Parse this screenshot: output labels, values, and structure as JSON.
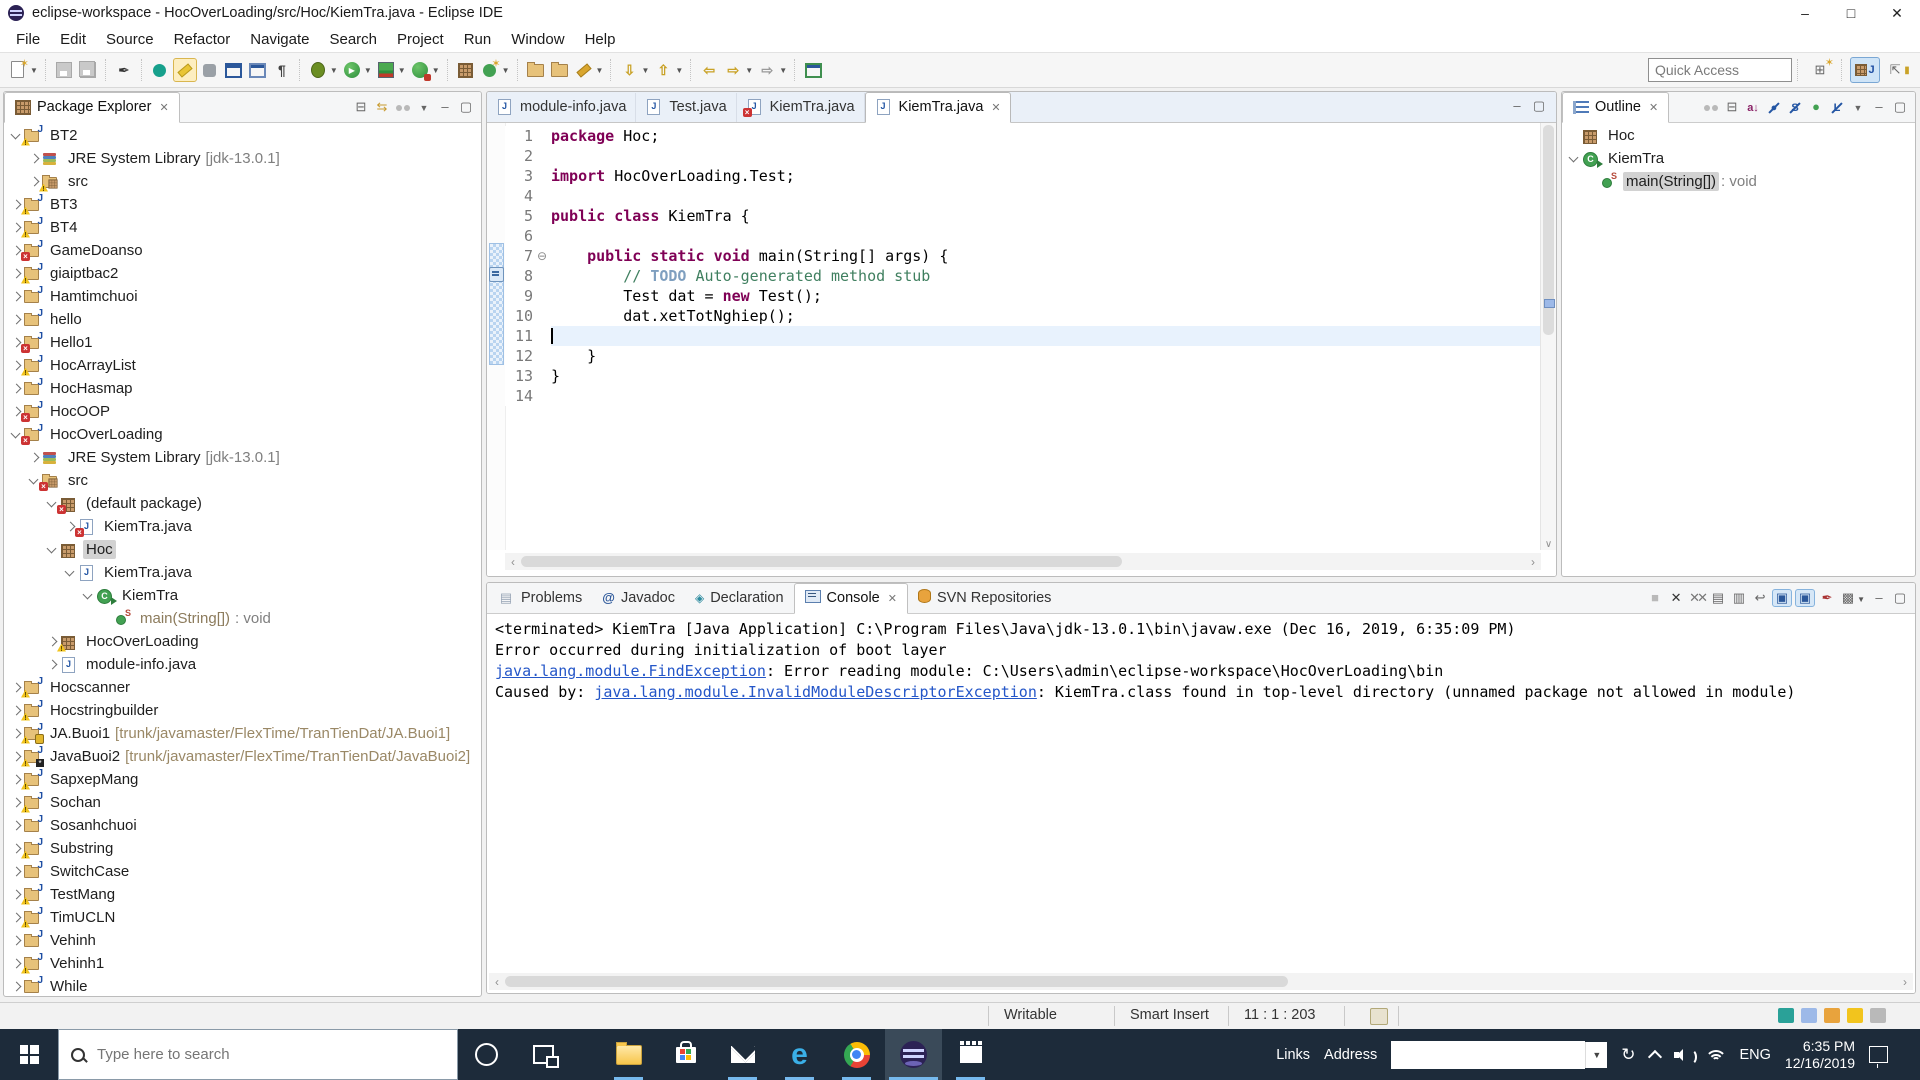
{
  "window": {
    "title": "eclipse-workspace - HocOverLoading/src/Hoc/KiemTra.java - Eclipse IDE",
    "controls": [
      "minimize",
      "maximize",
      "close"
    ]
  },
  "menu": {
    "items": [
      "File",
      "Edit",
      "Source",
      "Refactor",
      "Navigate",
      "Search",
      "Project",
      "Run",
      "Window",
      "Help"
    ]
  },
  "toolbar": {
    "quick_access_placeholder": "Quick Access",
    "groups": [
      [
        "new-wizard"
      ],
      [
        "save",
        "save-all"
      ],
      [
        "pin"
      ],
      [
        "external-tools",
        "mark-occurrences",
        "jar",
        "open-type",
        "templates",
        "show-whitespace"
      ],
      [
        "debug",
        "run",
        "coverage",
        "profile"
      ],
      [
        "new-java-project",
        "new-wizard-java"
      ],
      [
        "open-folder",
        "open-folder-2",
        "search-flashlight"
      ],
      [
        "next-annotation",
        "prev-annotation"
      ],
      [
        "back",
        "forward",
        "forward-gray"
      ],
      [
        "last-edit-location"
      ]
    ],
    "perspectives": [
      "open-perspective",
      "java-perspective",
      "jee-perspective"
    ]
  },
  "package_explorer": {
    "title": "Package Explorer",
    "toolbar": [
      "collapse-all-icon",
      "link-with-editor-icon",
      "focus-icon",
      "view-menu-icon",
      "minimize-icon",
      "maximize-icon"
    ],
    "items": [
      {
        "d": 0,
        "e": "v",
        "i": "prj",
        "b": [
          "w"
        ],
        "t": "BT2"
      },
      {
        "d": 1,
        "e": ">",
        "i": "jre",
        "t": "JRE System Library",
        "s": " [jdk-13.0.1]",
        "sc": "g"
      },
      {
        "d": 1,
        "e": ">",
        "i": "src",
        "b": [
          "w"
        ],
        "t": "src"
      },
      {
        "d": 0,
        "e": ">",
        "i": "prj",
        "b": [
          "w"
        ],
        "t": "BT3"
      },
      {
        "d": 0,
        "e": ">",
        "i": "prj",
        "b": [
          "w"
        ],
        "t": "BT4"
      },
      {
        "d": 0,
        "e": ">",
        "i": "prj",
        "b": [
          "e"
        ],
        "t": "GameDoanso"
      },
      {
        "d": 0,
        "e": ">",
        "i": "prj",
        "b": [
          "w"
        ],
        "t": "giaiptbac2"
      },
      {
        "d": 0,
        "e": ">",
        "i": "prj",
        "t": "Hamtimchuoi"
      },
      {
        "d": 0,
        "e": ">",
        "i": "prj",
        "t": "hello"
      },
      {
        "d": 0,
        "e": ">",
        "i": "prj",
        "b": [
          "e"
        ],
        "t": "Hello1"
      },
      {
        "d": 0,
        "e": ">",
        "i": "prj",
        "b": [
          "w"
        ],
        "t": "HocArrayList"
      },
      {
        "d": 0,
        "e": ">",
        "i": "prj",
        "t": "HocHasmap"
      },
      {
        "d": 0,
        "e": ">",
        "i": "prj",
        "b": [
          "e"
        ],
        "t": "HocOOP"
      },
      {
        "d": 0,
        "e": "v",
        "i": "prj",
        "b": [
          "e"
        ],
        "t": "HocOverLoading"
      },
      {
        "d": 1,
        "e": ">",
        "i": "jre",
        "t": "JRE System Library",
        "s": " [jdk-13.0.1]",
        "sc": "g"
      },
      {
        "d": 1,
        "e": "v",
        "i": "src",
        "b": [
          "e"
        ],
        "t": "src"
      },
      {
        "d": 2,
        "e": "v",
        "i": "pkg",
        "b": [
          "e"
        ],
        "t": "(default package)"
      },
      {
        "d": 3,
        "e": ">",
        "i": "jfile",
        "b": [
          "e"
        ],
        "t": "KiemTra.java"
      },
      {
        "d": 2,
        "e": "v",
        "i": "pkg",
        "t": "Hoc",
        "sel": true
      },
      {
        "d": 3,
        "e": "v",
        "i": "jfile",
        "t": "KiemTra.java"
      },
      {
        "d": 4,
        "e": "v",
        "i": "cls",
        "t": "KiemTra"
      },
      {
        "d": 5,
        "e": "",
        "i": "mth",
        "t": "main(String[])",
        "s": " : void",
        "sc": "g",
        "dim": true
      },
      {
        "d": 2,
        "e": ">",
        "i": "pkg",
        "b": [
          "w"
        ],
        "t": "HocOverLoading"
      },
      {
        "d": 2,
        "e": ">",
        "i": "jfile",
        "t": "module-info.java"
      },
      {
        "d": 0,
        "e": ">",
        "i": "prj",
        "b": [
          "w"
        ],
        "t": "Hocscanner"
      },
      {
        "d": 0,
        "e": ">",
        "i": "prj",
        "b": [
          "w"
        ],
        "t": "Hocstringbuilder"
      },
      {
        "d": 0,
        "e": ">",
        "i": "prj",
        "b": [
          "w",
          "k"
        ],
        "t": "JA.Buoi1",
        "s": " [trunk/javamaster/FlexTime/TranTienDat/JA.Buoi1]",
        "sc": "r"
      },
      {
        "d": 0,
        "e": ">",
        "i": "prj",
        "b": [
          "w",
          "s"
        ],
        "t": "JavaBuoi2",
        "s": " [trunk/javamaster/FlexTime/TranTienDat/JavaBuoi2]",
        "sc": "r"
      },
      {
        "d": 0,
        "e": ">",
        "i": "prj",
        "b": [
          "w"
        ],
        "t": "SapxepMang"
      },
      {
        "d": 0,
        "e": ">",
        "i": "prj",
        "b": [
          "w"
        ],
        "t": "Sochan"
      },
      {
        "d": 0,
        "e": ">",
        "i": "prj",
        "t": "Sosanhchuoi"
      },
      {
        "d": 0,
        "e": ">",
        "i": "prj",
        "b": [
          "w"
        ],
        "t": "Substring"
      },
      {
        "d": 0,
        "e": ">",
        "i": "prj",
        "t": "SwitchCase"
      },
      {
        "d": 0,
        "e": ">",
        "i": "prj",
        "b": [
          "w"
        ],
        "t": "TestMang"
      },
      {
        "d": 0,
        "e": ">",
        "i": "prj",
        "b": [
          "w"
        ],
        "t": "TimUCLN"
      },
      {
        "d": 0,
        "e": ">",
        "i": "prj",
        "t": "Vehinh"
      },
      {
        "d": 0,
        "e": ">",
        "i": "prj",
        "b": [
          "w"
        ],
        "t": "Vehinh1"
      },
      {
        "d": 0,
        "e": ">",
        "i": "prj",
        "t": "While"
      }
    ]
  },
  "editor": {
    "tabs": [
      {
        "t": "module-info.java",
        "i": "jfile"
      },
      {
        "t": "Test.java",
        "i": "jfile"
      },
      {
        "t": "KiemTra.java",
        "i": "jfile",
        "b": [
          "e"
        ]
      },
      {
        "t": "KiemTra.java",
        "i": "jfile",
        "active": true,
        "close": true
      }
    ],
    "lines": [
      {
        "n": 1,
        "segs": [
          [
            "kw",
            "package"
          ],
          [
            "pl",
            " Hoc;"
          ]
        ]
      },
      {
        "n": 2,
        "segs": []
      },
      {
        "n": 3,
        "segs": [
          [
            "kw",
            "import"
          ],
          [
            "pl",
            " HocOverLoading.Test;"
          ]
        ]
      },
      {
        "n": 4,
        "segs": []
      },
      {
        "n": 5,
        "segs": [
          [
            "kw",
            "public"
          ],
          [
            "pl",
            " "
          ],
          [
            "kw",
            "class"
          ],
          [
            "pl",
            " KiemTra {"
          ]
        ]
      },
      {
        "n": 6,
        "segs": []
      },
      {
        "n": 7,
        "fold": true,
        "segs": [
          [
            "pl",
            "    "
          ],
          [
            "kw",
            "public"
          ],
          [
            "pl",
            " "
          ],
          [
            "kw",
            "static"
          ],
          [
            "pl",
            " "
          ],
          [
            "kw",
            "void"
          ],
          [
            "pl",
            " main(String[] args) {"
          ]
        ]
      },
      {
        "n": 8,
        "segs": [
          [
            "pl",
            "        "
          ],
          [
            "cm",
            "// "
          ],
          [
            "td",
            "TODO"
          ],
          [
            "cm",
            " Auto-generated method stub"
          ]
        ]
      },
      {
        "n": 9,
        "segs": [
          [
            "pl",
            "        Test dat = "
          ],
          [
            "kw",
            "new"
          ],
          [
            "pl",
            " Test();"
          ]
        ]
      },
      {
        "n": 10,
        "segs": [
          [
            "pl",
            "        dat.xetTotNghiep();"
          ]
        ]
      },
      {
        "n": 11,
        "cur": true,
        "segs": []
      },
      {
        "n": 12,
        "segs": [
          [
            "pl",
            "    }"
          ]
        ]
      },
      {
        "n": 13,
        "segs": [
          [
            "pl",
            "}"
          ]
        ]
      },
      {
        "n": 14,
        "segs": []
      }
    ]
  },
  "outline": {
    "title": "Outline",
    "toolbar": [
      "focus-icon",
      "collapse-all-icon",
      "sort-icon",
      "hide-fields-icon",
      "hide-static-icon",
      "hide-non-public-icon",
      "hide-local-types-icon",
      "view-menu-icon",
      "minimize-icon",
      "maximize-icon"
    ],
    "items": [
      {
        "d": 0,
        "e": "",
        "i": "pkg",
        "t": "Hoc"
      },
      {
        "d": 0,
        "e": "v",
        "i": "cls",
        "t": "KiemTra"
      },
      {
        "d": 1,
        "e": "",
        "i": "mth",
        "t": "main(String[])",
        "s": " : void",
        "sc": "g",
        "sel": true
      }
    ]
  },
  "console": {
    "tabs": [
      {
        "t": "Problems",
        "i": "problems"
      },
      {
        "t": "Javadoc",
        "i": "javadoc"
      },
      {
        "t": "Declaration",
        "i": "declaration"
      },
      {
        "t": "Console",
        "i": "console",
        "active": true,
        "close": true
      },
      {
        "t": "SVN Repositories",
        "i": "svn"
      }
    ],
    "toolbar": [
      "terminate-icon",
      "close-console-icon",
      "remove-all-launches-icon",
      "clear-console-icon",
      "scroll-lock-icon",
      "word-wrap-icon",
      "stdout-lock-icon",
      "stderr-lock-icon",
      "pin-console-icon",
      "open-console-icon",
      "minimize-icon",
      "maximize-icon"
    ],
    "title_line": "<terminated> KiemTra [Java Application] C:\\Program Files\\Java\\jdk-13.0.1\\bin\\javaw.exe (Dec 16, 2019, 6:35:09 PM)",
    "lines": [
      [
        [
          "p",
          "Error occurred during initialization of boot layer"
        ]
      ],
      [
        [
          "l",
          "java.lang.module.FindException"
        ],
        [
          "p",
          ": Error reading module: C:\\Users\\admin\\eclipse-workspace\\HocOverLoading\\bin"
        ]
      ],
      [
        [
          "p",
          "Caused by: "
        ],
        [
          "l",
          "java.lang.module.InvalidModuleDescriptorException"
        ],
        [
          "p",
          ": KiemTra.class found in top-level directory (unnamed package not allowed in module)"
        ]
      ]
    ]
  },
  "status_bar": {
    "writable": "Writable",
    "insert_mode": "Smart Insert",
    "position": "11 : 1 : 203"
  },
  "taskbar": {
    "search_placeholder": "Type here to search",
    "links_label": "Links",
    "address_label": "Address",
    "language": "ENG",
    "time": "6:35 PM",
    "date": "12/16/2019",
    "apps": [
      {
        "n": "file-explorer",
        "open": true
      },
      {
        "n": "store",
        "open": false
      },
      {
        "n": "mail",
        "open": true
      },
      {
        "n": "edge",
        "open": true
      },
      {
        "n": "chrome",
        "open": true
      },
      {
        "n": "eclipse",
        "open": true,
        "active": true
      },
      {
        "n": "movies-tv",
        "open": true
      }
    ]
  },
  "colors": {
    "keyword": "#7f0055",
    "comment": "#3f7f5f",
    "todo_tag": "#7f9fbf",
    "console_link": "#2456c8",
    "current_line": "#e8f2fd",
    "selection_gray": "#d2d2d2",
    "taskbar_bg": "#1d2b3a",
    "taskbar_accent": "#76b9ed",
    "error_badge": "#cc3333",
    "warning_badge": "#f2c41d"
  }
}
